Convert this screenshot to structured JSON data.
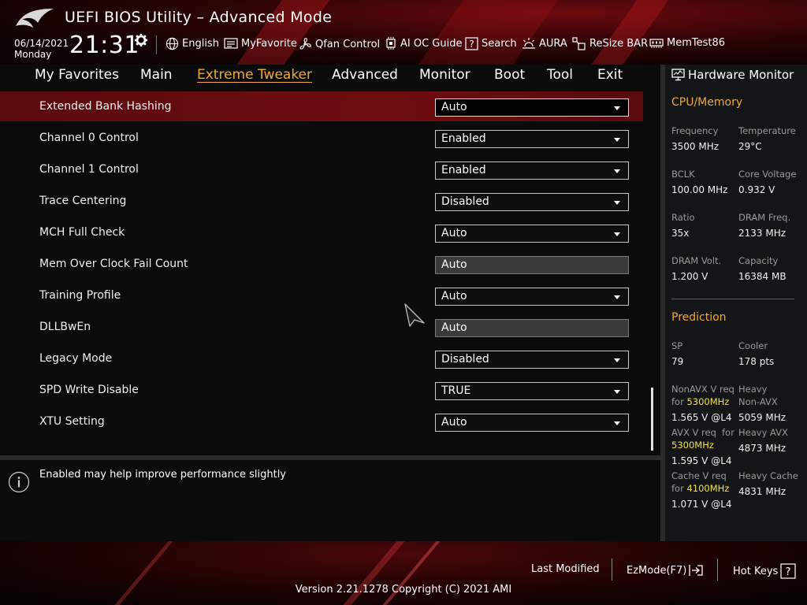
{
  "header": {
    "title": "UEFI BIOS Utility – Advanced Mode",
    "date": "06/14/2021",
    "day": "Monday",
    "time": "21:31",
    "tools": [
      {
        "label": "English",
        "icon": "globe-icon"
      },
      {
        "label": "MyFavorite",
        "icon": "favorite-list-icon"
      },
      {
        "label": "Qfan Control",
        "icon": "fan-icon"
      },
      {
        "label": "AI OC Guide",
        "icon": "chip-icon"
      },
      {
        "label": "Search",
        "icon": "question-box-icon"
      },
      {
        "label": "AURA",
        "icon": "aura-light-icon"
      },
      {
        "label": "ReSize BAR",
        "icon": "resize-bar-icon"
      },
      {
        "label": "MemTest86",
        "icon": "memory-icon"
      }
    ]
  },
  "nav": {
    "tabs": [
      {
        "label": "My Favorites"
      },
      {
        "label": "Main"
      },
      {
        "label": "Extreme Tweaker",
        "active": true
      },
      {
        "label": "Advanced"
      },
      {
        "label": "Monitor"
      },
      {
        "label": "Boot"
      },
      {
        "label": "Tool"
      },
      {
        "label": "Exit"
      }
    ]
  },
  "settings": [
    {
      "label": "Extended Bank Hashing",
      "value": "Auto",
      "selected": true
    },
    {
      "label": "Channel 0 Control",
      "value": "Enabled"
    },
    {
      "label": "Channel 1 Control",
      "value": "Enabled"
    },
    {
      "label": "Trace Centering",
      "value": "Disabled"
    },
    {
      "label": "MCH Full Check",
      "value": "Auto"
    },
    {
      "label": "Mem Over Clock Fail Count",
      "value": "Auto",
      "readonly": true
    },
    {
      "label": "Training Profile",
      "value": "Auto"
    },
    {
      "label": "DLLBwEn",
      "value": "Auto",
      "readonly": true
    },
    {
      "label": "Legacy Mode",
      "value": "Disabled"
    },
    {
      "label": "SPD Write Disable",
      "value": "TRUE"
    },
    {
      "label": "XTU Setting",
      "value": "Auto"
    }
  ],
  "help": {
    "text": "Enabled may help improve performance slightly"
  },
  "hardware_monitor": {
    "title": "Hardware Monitor",
    "cpu_memory": {
      "title": "CPU/Memory",
      "frequency_label": "Frequency",
      "frequency": "3500 MHz",
      "temperature_label": "Temperature",
      "temperature": "29°C",
      "bclk_label": "BCLK",
      "bclk": "100.00 MHz",
      "core_voltage_label": "Core Voltage",
      "core_voltage": "0.932 V",
      "ratio_label": "Ratio",
      "ratio": "35x",
      "dram_freq_label": "DRAM Freq.",
      "dram_freq": "2133 MHz",
      "dram_volt_label": "DRAM Volt.",
      "dram_volt": "1.200 V",
      "capacity_label": "Capacity",
      "capacity": "16384 MB"
    },
    "prediction": {
      "title": "Prediction",
      "sp_label": "SP",
      "sp": "79",
      "cooler_label": "Cooler",
      "cooler": "178 pts",
      "nonavx_label": "NonAVX V req",
      "nonavx_for": "for",
      "nonavx_freq": "5300MHz",
      "nonavx_value": "1.565 V @L4",
      "heavy_nonavx_label_1": "Heavy",
      "heavy_nonavx_label_2": "Non-AVX",
      "heavy_nonavx_value": "5059 MHz",
      "avx_label": "AVX V req",
      "avx_for": "for",
      "avx_freq": "5300MHz",
      "avx_value": "1.595 V @L4",
      "heavy_avx_label": "Heavy AVX",
      "heavy_avx_value": "4873 MHz",
      "cache_label": "Cache V req",
      "cache_for": "for",
      "cache_freq": "4100MHz",
      "cache_value": "1.071 V @L4",
      "heavy_cache_label": "Heavy Cache",
      "heavy_cache_value": "4831 MHz"
    }
  },
  "footer": {
    "last_modified": "Last Modified",
    "ezmode": "EzMode(F7)",
    "hot_keys": "Hot Keys",
    "version": "Version 2.21.1278 Copyright (C) 2021 AMI"
  },
  "colors": {
    "accent": "#f0a93a",
    "highlight": "#f2e04a",
    "selected_row": "#6e0d10"
  }
}
